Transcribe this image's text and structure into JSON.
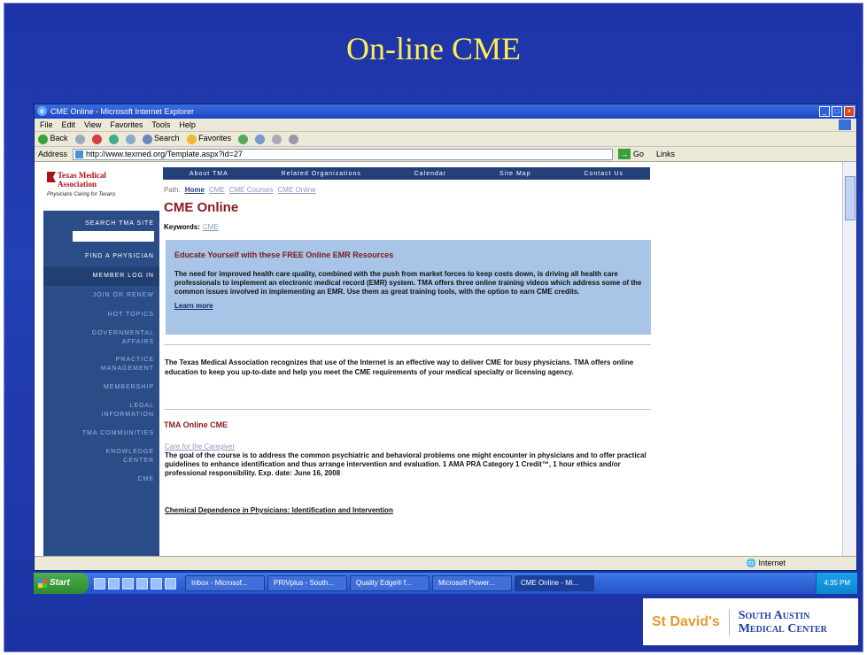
{
  "slide": {
    "title": "On-line CME"
  },
  "browser": {
    "title": "CME Online - Microsoft Internet Explorer",
    "menu": [
      "File",
      "Edit",
      "View",
      "Favorites",
      "Tools",
      "Help"
    ],
    "toolbar": {
      "back": "Back",
      "search": "Search",
      "favorites": "Favorites"
    },
    "address_label": "Address",
    "address_value": "http://www.texmed.org/Template.aspx?id=27",
    "go": "Go",
    "links": "Links",
    "status": "Internet"
  },
  "site": {
    "logo_line1": "Texas Medical",
    "logo_line2": "Association",
    "logo_tagline": "Physicians Caring for Texans",
    "nav": {
      "search_label": "Search TMA Site",
      "items": [
        "Find a Physician",
        "Member Log In",
        "Join or Renew",
        "Hot Topics",
        "Governmental Affairs",
        "Practice Management",
        "Membership",
        "Legal Information",
        "TMA Communities",
        "Knowledge Center",
        "CME"
      ]
    },
    "topnav": [
      "About TMA",
      "Related Organizations",
      "Calendar",
      "Site Map",
      "Contact Us"
    ],
    "breadcrumb": {
      "label": "Path:",
      "items": [
        "Home",
        "CME",
        "CME Courses",
        "CME Online"
      ]
    },
    "heading": "CME Online",
    "keywords_label": "Keywords:",
    "keywords_value": "CME",
    "promo": {
      "title": "Educate Yourself with these FREE Online EMR Resources",
      "body": "The need for improved health care quality, combined with the push from market forces to keep costs down, is driving all health care professionals to implement an electronic medical record (EMR) system. TMA offers three online training videos which address some of the common issues involved in implementing an EMR. Use them as great training tools, with the option to earn CME credits.",
      "more": "Learn more"
    },
    "intro": "The Texas Medical Association recognizes that use of the Internet is an effective way to deliver CME for busy physicians. TMA offers online education to keep you up-to-date and help you meet the CME requirements of your medical specialty or licensing agency.",
    "section_title": "TMA Online CME",
    "course1": {
      "link": "Care for the Caregiver",
      "desc": "The goal of the course is to address the common psychiatric and behavioral problems one might encounter in physicians and to offer practical guidelines to enhance identification and thus arrange intervention and evaluation. 1 AMA PRA Category 1 Credit™, 1 hour ethics and/or professional responsibility. Exp. date: June 16, 2008"
    },
    "course2": "Chemical Dependence in Physicians: Identification and Intervention"
  },
  "taskbar": {
    "start": "Start",
    "buttons": [
      "Inbox - Microsof...",
      "PRIVplus - South...",
      "Quality Edge® f...",
      "Microsoft Power...",
      "CME Online - Mi..."
    ],
    "clock": "4:35 PM"
  },
  "footer": {
    "logo1": "St David's",
    "logo2_line1": "South Austin",
    "logo2_line2": "Medical Center"
  }
}
